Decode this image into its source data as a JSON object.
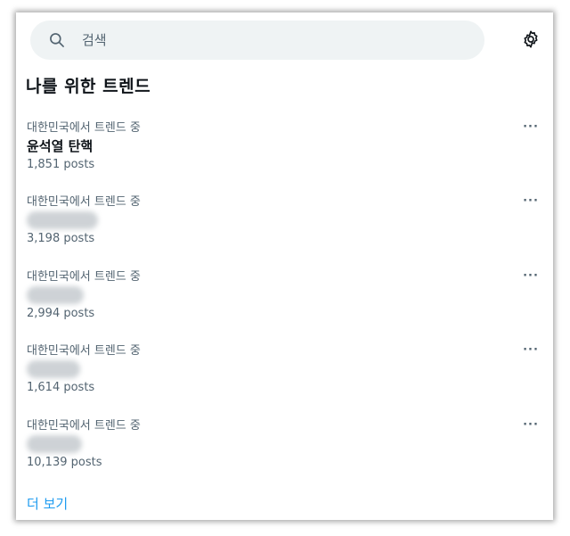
{
  "search": {
    "placeholder": "검색"
  },
  "icons": {
    "search": "search-icon",
    "settings": "gear-icon",
    "more": "more-horizontal-icon"
  },
  "section_title": "나를 위한 트렌드",
  "trends": [
    {
      "context": "대한민국에서 트렌드 중",
      "name": "윤석열 탄핵",
      "posts": "1,851 posts",
      "more": "···"
    },
    {
      "context": "대한민국에서 트렌드 중",
      "name": "",
      "posts": "3,198 posts",
      "more": "···"
    },
    {
      "context": "대한민국에서 트렌드 중",
      "name": "",
      "posts": "2,994 posts",
      "more": "···"
    },
    {
      "context": "대한민국에서 트렌드 중",
      "name": "",
      "posts": "1,614 posts",
      "more": "···"
    },
    {
      "context": "대한민국에서 트렌드 중",
      "name": "",
      "posts": "10,139 posts",
      "more": "···"
    }
  ],
  "show_more": "더 보기",
  "colors": {
    "accent": "#1d9bf0",
    "secondary_text": "#536471",
    "primary_text": "#0f1419",
    "search_bg": "#eff3f4"
  }
}
